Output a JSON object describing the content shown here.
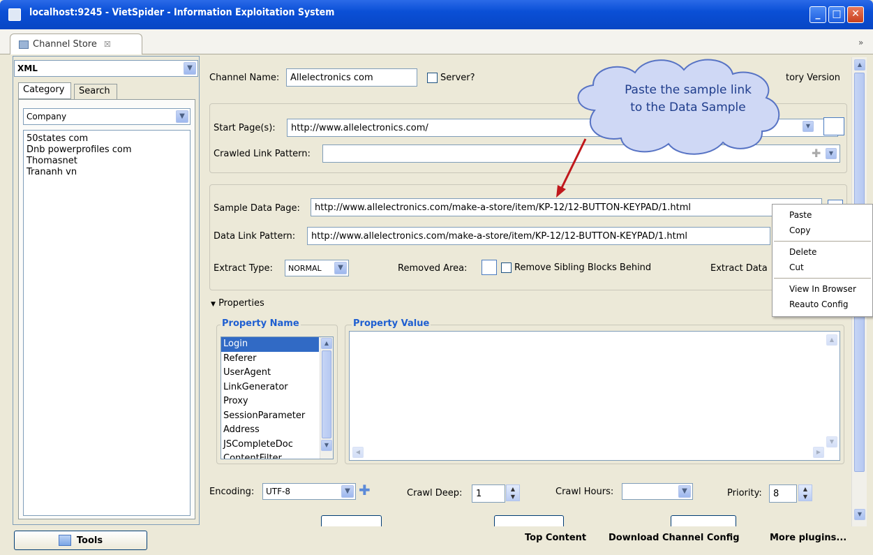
{
  "window": {
    "title": "localhost:9245 - VietSpider - Information Exploitation System"
  },
  "tabs": {
    "channel_store": "Channel Store",
    "close_glyph": "☒",
    "overflow": "»"
  },
  "left": {
    "source_select": "XML",
    "tabs": [
      "Category",
      "Search"
    ],
    "category_select": "Company",
    "items": [
      "50states com",
      "Dnb powerprofiles com",
      "Thomasnet",
      "Trananh vn"
    ]
  },
  "form": {
    "channel_name_label": "Channel Name:",
    "channel_name_value": "Allelectronics com",
    "server_label": "Server?",
    "history_label": "tory Version",
    "start_pages_label": "Start Page(s):",
    "start_pages_value": "http://www.allelectronics.com/",
    "crawled_link_label": "Crawled Link Pattern:",
    "crawled_link_value": "",
    "sample_page_label": "Sample Data Page:",
    "sample_page_value": "http://www.allelectronics.com/make-a-store/item/KP-12/12-BUTTON-KEYPAD/1.html",
    "data_link_label": "Data Link Pattern:",
    "data_link_value": "http://www.allelectronics.com/make-a-store/item/KP-12/12-BUTTON-KEYPAD/1.html",
    "extract_type_label": "Extract Type:",
    "extract_type_value": "NORMAL",
    "removed_area_label": "Removed Area:",
    "remove_sibling_label": "Remove Sibling Blocks Behind",
    "extract_data_label": "Extract Data"
  },
  "properties": {
    "toggle_label": "Properties",
    "name_header": "Property Name",
    "value_header": "Property Value",
    "names": [
      "Login",
      "Referer",
      "UserAgent",
      "LinkGenerator",
      "Proxy",
      "SessionParameter",
      "Address",
      "JSCompleteDoc",
      "ContentFilter"
    ],
    "selected": "Login"
  },
  "settings": {
    "encoding_label": "Encoding:",
    "encoding_value": "UTF-8",
    "crawl_deep_label": "Crawl Deep:",
    "crawl_deep_value": "1",
    "crawl_hours_label": "Crawl Hours:",
    "crawl_hours_value": "",
    "priority_label": "Priority:",
    "priority_value": "8"
  },
  "context_menu": {
    "items": [
      "Paste",
      "Copy",
      "Delete",
      "Cut",
      "View In Browser",
      "Reauto Config"
    ]
  },
  "callout": {
    "line1": "Paste the sample link",
    "line2": "to the Data Sample"
  },
  "footer": {
    "tools": "Tools",
    "top_content": "Top Content",
    "download": "Download Channel Config",
    "more": "More plugins..."
  },
  "colors": {
    "accent": "#0a4fd6",
    "header_blue": "#1f5fd1",
    "callout_text": "#1f3d8c"
  }
}
